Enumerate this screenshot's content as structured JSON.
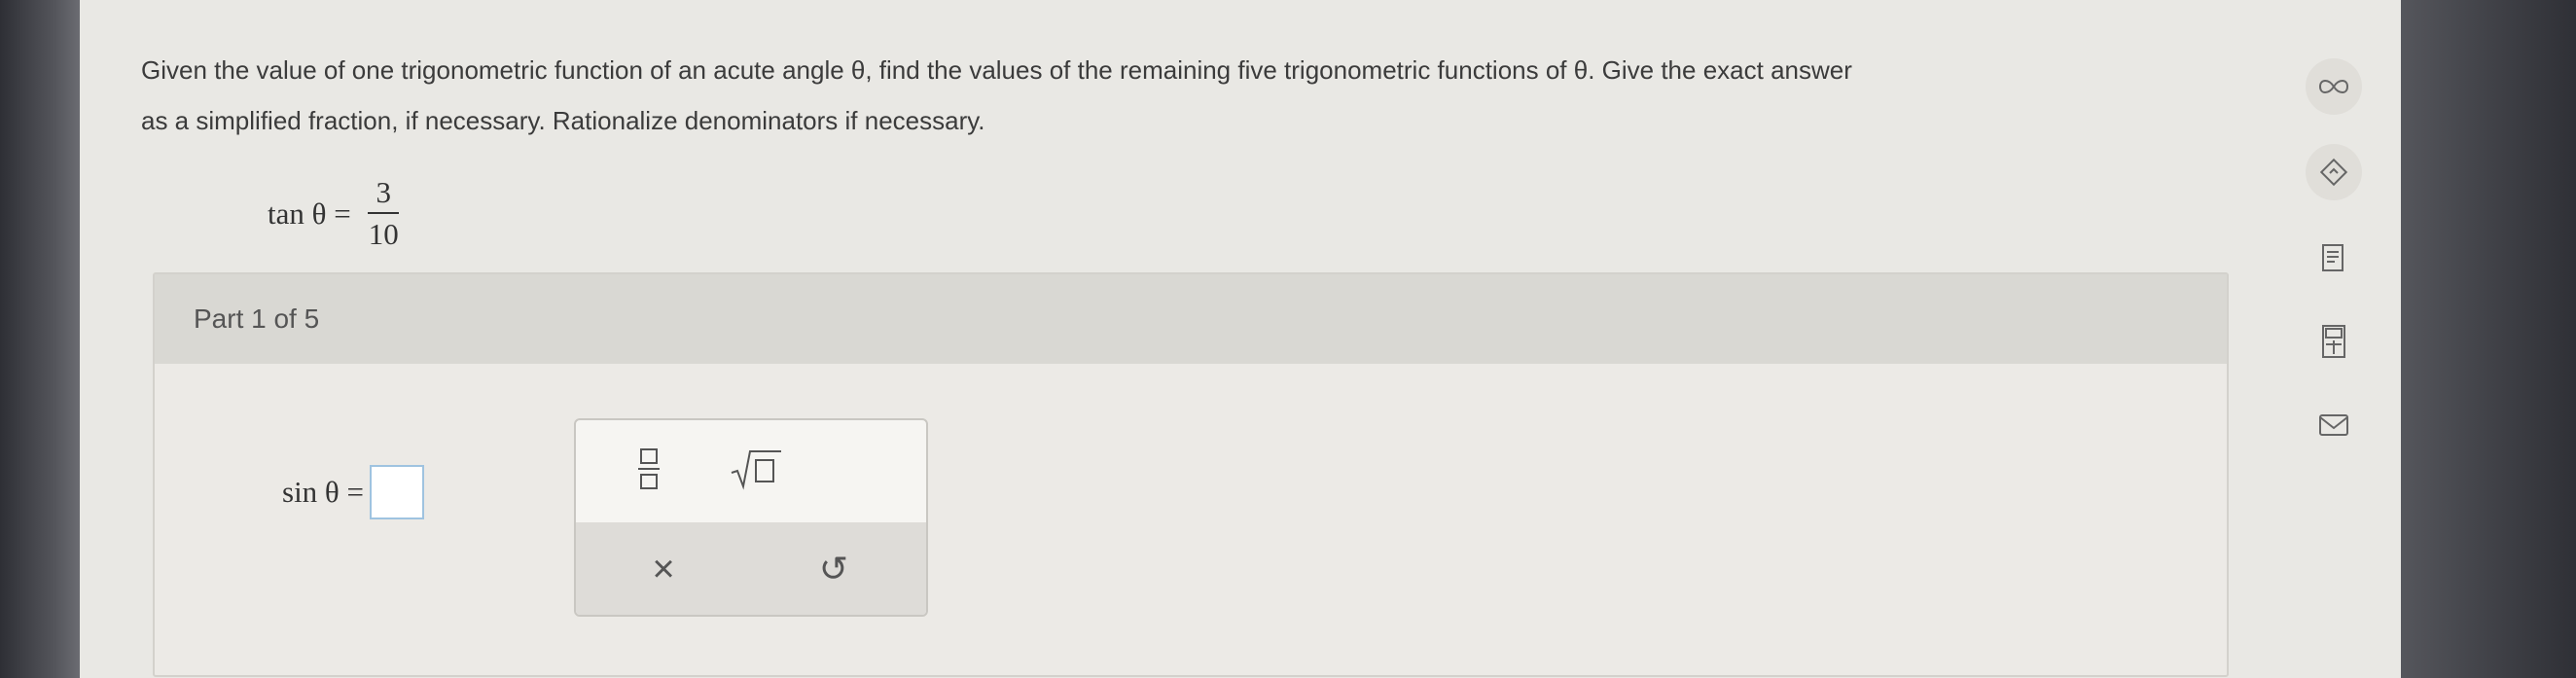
{
  "question": {
    "text_line1": "Given the value of one trigonometric function of an acute angle θ, find the values of the remaining five trigonometric functions of θ. Give the exact answer",
    "text_line2": "as a simplified fraction, if necessary. Rationalize denominators if necessary."
  },
  "given": {
    "lhs": "tan θ =",
    "numerator": "3",
    "denominator": "10"
  },
  "part": {
    "label": "Part 1 of 5"
  },
  "answer": {
    "lhs": "sin θ ="
  },
  "palette": {
    "clear_symbol": "×",
    "undo_symbol": "↺"
  },
  "side_icons": [
    "infinity-icon",
    "tag-icon",
    "document-icon",
    "calculator-icon",
    "mail-icon"
  ]
}
